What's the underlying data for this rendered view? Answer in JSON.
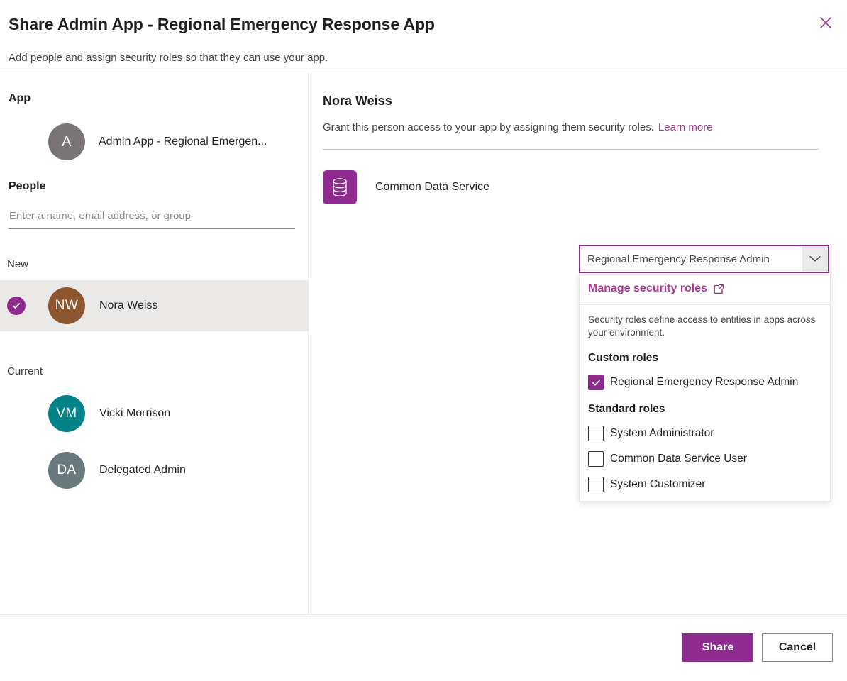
{
  "header": {
    "title": "Share Admin App - Regional Emergency Response App",
    "subtitle": "Add people and assign security roles so that they can use your app.",
    "close_label": "Close"
  },
  "left_pane": {
    "app_section_heading": "App",
    "app": {
      "initial": "A",
      "name": "Admin App - Regional Emergen...",
      "avatar_color": "#7a7574"
    },
    "people_section_heading": "People",
    "people_input": {
      "value": "",
      "placeholder": "Enter a name, email address, or group"
    },
    "groups": [
      {
        "label": "New",
        "people": [
          {
            "initials": "NW",
            "name": "Nora Weiss",
            "avatar_color": "#8e562e",
            "selected": true
          }
        ]
      },
      {
        "label": "Current",
        "people": [
          {
            "initials": "VM",
            "name": "Vicki Morrison",
            "avatar_color": "#038387",
            "selected": false
          },
          {
            "initials": "DA",
            "name": "Delegated Admin",
            "avatar_color": "#69797e",
            "selected": false
          }
        ]
      }
    ]
  },
  "right_pane": {
    "person_name": "Nora Weiss",
    "description": "Grant this person access to your app by assigning them security roles.",
    "learn_more_label": "Learn more",
    "service": {
      "name": "Common Data Service",
      "icon": "database-icon",
      "icon_color": "#8f2b8f"
    },
    "role_combobox": {
      "value": "Regional Emergency Response Admin",
      "expanded": true
    },
    "dropdown": {
      "manage_roles_label": "Manage security roles",
      "manage_roles_icon": "open-in-new-window-icon",
      "description": "Security roles define access to entities in apps across your environment.",
      "groups": [
        {
          "title": "Custom roles",
          "roles": [
            {
              "label": "Regional Emergency Response Admin",
              "checked": true
            }
          ]
        },
        {
          "title": "Standard roles",
          "roles": [
            {
              "label": "System Administrator",
              "checked": false
            },
            {
              "label": "Common Data Service User",
              "checked": false
            },
            {
              "label": "System Customizer",
              "checked": false
            }
          ]
        }
      ]
    }
  },
  "footer": {
    "primary_label": "Share",
    "secondary_label": "Cancel"
  },
  "colors": {
    "accent": "#8f2b8f",
    "link": "#a4378f"
  }
}
